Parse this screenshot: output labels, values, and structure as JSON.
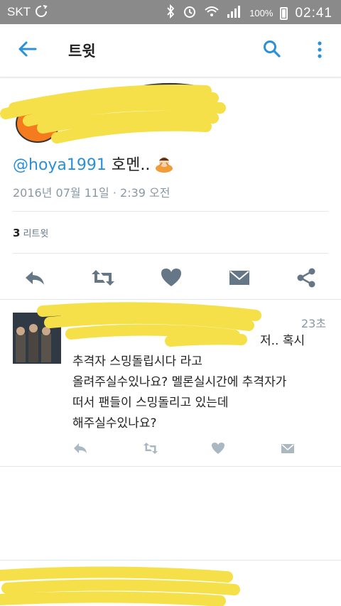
{
  "status_bar": {
    "carrier": "SKT",
    "battery_percent": "100%",
    "time": "02:41"
  },
  "toolbar": {
    "title": "트윗",
    "back_icon": "arrow-left-icon",
    "search_icon": "search-icon",
    "more_icon": "more-vertical-icon"
  },
  "tweet": {
    "mention": "@hoya1991",
    "text": " 호멘..",
    "emoji_icon": "person-bowing-icon",
    "timestamp": "2016년 07월 11일 · 2:39 오전",
    "retweet_count": "3",
    "retweet_label": "리트윗"
  },
  "actions": [
    "reply-icon",
    "retweet-icon",
    "like-icon",
    "message-icon",
    "share-icon"
  ],
  "reply": {
    "time": "23초",
    "lines": [
      "저.. 혹시",
      "추격자 스밍돌립시다 라고",
      "올려주실수있나요? 멜론실시간에 추격자가",
      "떠서 팬들이 스밍돌리고 있는데",
      "해주실수있나요?"
    ]
  },
  "colors": {
    "accent": "#2a90d8",
    "status_bar": "#8a8a8a",
    "redaction": "#f5e04a",
    "icon_gray": "#657786"
  }
}
